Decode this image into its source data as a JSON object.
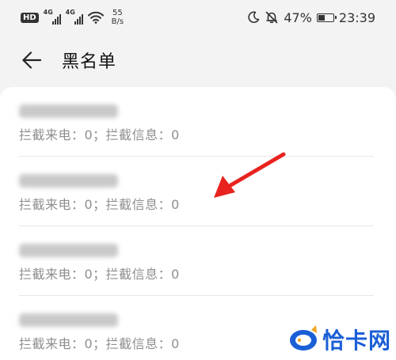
{
  "status_bar": {
    "hd_label": "HD",
    "sim1_label": "4G",
    "sim2_label": "4G",
    "speed_value": "55",
    "speed_unit": "B/s",
    "battery_percent": "47%",
    "battery_level": 0.47,
    "time": "23:39",
    "icons": [
      "hd-icon",
      "signal-icon",
      "wifi-icon",
      "moon-icon",
      "bell-off-icon",
      "battery-icon"
    ]
  },
  "header": {
    "title": "黑名单",
    "back_icon": "arrow-left-icon"
  },
  "blacklist": {
    "items": [
      {
        "stats": "拦截来电：0；拦截信息：0"
      },
      {
        "stats": "拦截来电：0；拦截信息：0"
      },
      {
        "stats": "拦截来电：0；拦截信息：0"
      },
      {
        "stats": "拦截来电：0；拦截信息：0"
      }
    ]
  },
  "annotation": {
    "arrow_color": "#e8231f"
  },
  "watermark": {
    "text": "恰卡网",
    "brand_color": "#1b5fd6"
  }
}
